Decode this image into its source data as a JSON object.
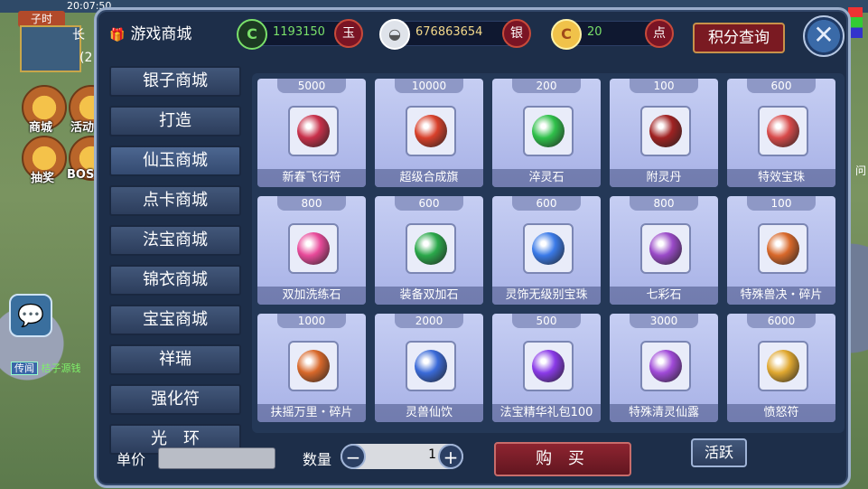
{
  "hud": {
    "time_label": "子时",
    "clock": "20:07:50",
    "city": "长",
    "line_num": "(2",
    "btn_shop": "商城",
    "btn_activity": "活动",
    "btn_lottery": "抽奖",
    "btn_boss": "BOSS",
    "news_tag": "传闻",
    "news_text": "桔子源钱",
    "right_hint": "问"
  },
  "header": {
    "title": "游戏商城",
    "currencies": [
      {
        "icon": "jade-coin-icon",
        "value": "1193150",
        "unit": "玉",
        "color": "#7ae06a"
      },
      {
        "icon": "silver-ingot-icon",
        "value": "676863654",
        "unit": "银",
        "color": "#f3d88a"
      },
      {
        "icon": "point-card-icon",
        "value": "20",
        "unit": "点",
        "color": "#7ae06a"
      }
    ],
    "query_button": "积分查询",
    "close_glyph": "✕"
  },
  "sidebar": {
    "items": [
      {
        "label": "银子商城"
      },
      {
        "label": "打造"
      },
      {
        "label": "仙玉商城"
      },
      {
        "label": "点卡商城"
      },
      {
        "label": "法宝商城"
      },
      {
        "label": "锦衣商城"
      },
      {
        "label": "宝宝商城"
      },
      {
        "label": "祥瑞"
      },
      {
        "label": "强化符"
      },
      {
        "label": "光　环"
      }
    ],
    "active_index": 2
  },
  "items": [
    {
      "price": "5000",
      "name": "新春飞行符",
      "icon": "flying-charm-icon",
      "color": "#c8304a"
    },
    {
      "price": "10000",
      "name": "超级合成旗",
      "icon": "synthesis-flag-icon",
      "color": "#d8402a"
    },
    {
      "price": "200",
      "name": "淬灵石",
      "icon": "green-stone-icon",
      "color": "#2fc04a"
    },
    {
      "price": "100",
      "name": "附灵丹",
      "icon": "red-pill-icon",
      "color": "#a02222"
    },
    {
      "price": "600",
      "name": "特效宝珠",
      "icon": "crystal-ball-icon",
      "color": "#d84a4a"
    },
    {
      "price": "800",
      "name": "双加洗练石",
      "icon": "pink-flame-stone-icon",
      "color": "#e84a9a"
    },
    {
      "price": "600",
      "name": "装备双加石",
      "icon": "green-crystal-icon",
      "color": "#2aa84a"
    },
    {
      "price": "600",
      "name": "灵饰无级别宝珠",
      "icon": "blue-orb-icon",
      "color": "#3a7ae8"
    },
    {
      "price": "800",
      "name": "七彩石",
      "icon": "rainbow-stone-icon",
      "color": "#9a4ac8"
    },
    {
      "price": "100",
      "name": "特殊兽决・碎片",
      "icon": "scroll-fragment-icon",
      "color": "#d8682a"
    },
    {
      "price": "1000",
      "name": "扶摇万里・碎片",
      "icon": "scroll-fragment-icon",
      "color": "#d8682a"
    },
    {
      "price": "2000",
      "name": "灵兽仙饮",
      "icon": "porcelain-vase-icon",
      "color": "#3a6ad8"
    },
    {
      "price": "500",
      "name": "法宝精华礼包100",
      "icon": "purple-flame-icon",
      "color": "#8a3ae8"
    },
    {
      "price": "3000",
      "name": "特殊清灵仙露",
      "icon": "purple-vase-icon",
      "color": "#a04ad8"
    },
    {
      "price": "6000",
      "name": "愤怒符",
      "icon": "golden-scroll-icon",
      "color": "#e0a830"
    }
  ],
  "footer": {
    "unit_price_label": "单价",
    "unit_price_value": "",
    "quantity_label": "数量",
    "quantity_value": "1",
    "minus": "−",
    "plus": "+",
    "buy_button": "购 买",
    "active_button": "活跃"
  }
}
